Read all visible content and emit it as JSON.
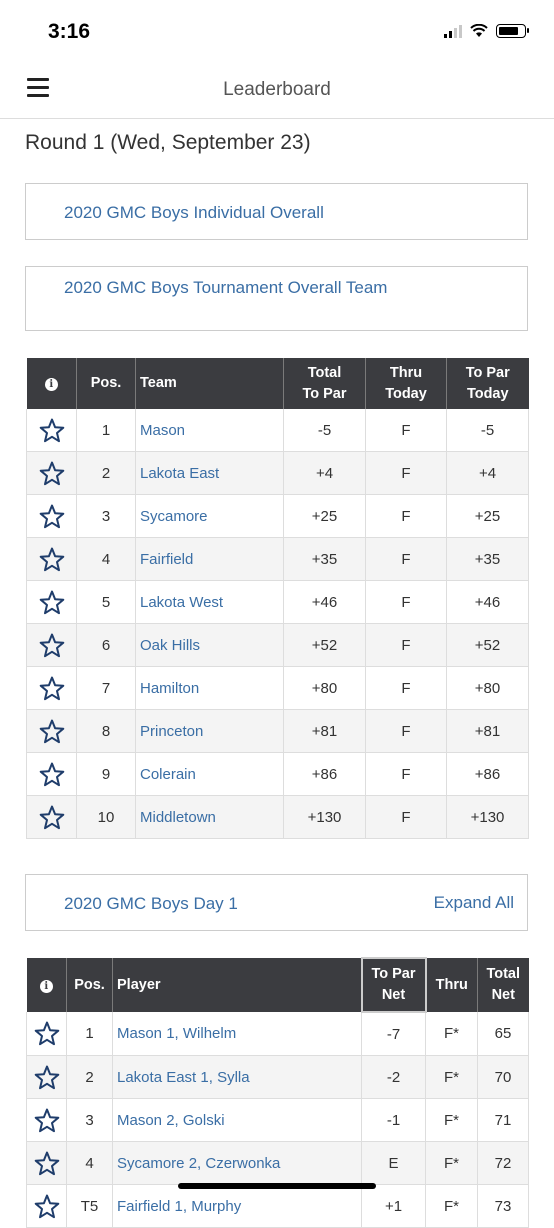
{
  "status_bar": {
    "time": "3:16",
    "signal_icon": "cellular-signal-icon",
    "wifi_icon": "wifi-icon",
    "battery_icon": "battery-icon"
  },
  "nav": {
    "title": "Leaderboard",
    "menu_icon": "hamburger-menu-icon"
  },
  "round_title": "Round 1 (Wed, September 23)",
  "links": {
    "individual_overall": "2020 GMC Boys Individual Overall",
    "team_overall": "2020 GMC Boys Tournament Overall Team"
  },
  "team_table": {
    "headers": {
      "info": "i",
      "pos": "Pos.",
      "team": "Team",
      "total_to_par_1": "Total",
      "total_to_par_2": "To Par",
      "thru_1": "Thru",
      "thru_2": "Today",
      "to_par_today_1": "To Par",
      "to_par_today_2": "Today"
    },
    "rows": [
      {
        "pos": "1",
        "team": "Mason",
        "total": "-5",
        "thru": "F",
        "today": "-5"
      },
      {
        "pos": "2",
        "team": "Lakota East",
        "total": "+4",
        "thru": "F",
        "today": "+4"
      },
      {
        "pos": "3",
        "team": "Sycamore",
        "total": "+25",
        "thru": "F",
        "today": "+25"
      },
      {
        "pos": "4",
        "team": "Fairfield",
        "total": "+35",
        "thru": "F",
        "today": "+35"
      },
      {
        "pos": "5",
        "team": "Lakota West",
        "total": "+46",
        "thru": "F",
        "today": "+46"
      },
      {
        "pos": "6",
        "team": "Oak Hills",
        "total": "+52",
        "thru": "F",
        "today": "+52"
      },
      {
        "pos": "7",
        "team": "Hamilton",
        "total": "+80",
        "thru": "F",
        "today": "+80"
      },
      {
        "pos": "8",
        "team": "Princeton",
        "total": "+81",
        "thru": "F",
        "today": "+81"
      },
      {
        "pos": "9",
        "team": "Colerain",
        "total": "+86",
        "thru": "F",
        "today": "+86"
      },
      {
        "pos": "10",
        "team": "Middletown",
        "total": "+130",
        "thru": "F",
        "today": "+130"
      }
    ]
  },
  "day1": {
    "title": "2020 GMC Boys Day 1",
    "expand_all": "Expand All"
  },
  "player_table": {
    "headers": {
      "info": "i",
      "pos": "Pos.",
      "player": "Player",
      "to_par_net_1": "To Par",
      "to_par_net_2": "Net",
      "thru": "Thru",
      "total_net_1": "Total",
      "total_net_2": "Net"
    },
    "rows": [
      {
        "pos": "1",
        "player": "Mason 1, Wilhelm",
        "to_par": "-7",
        "thru": "F*",
        "total": "65"
      },
      {
        "pos": "2",
        "player": "Lakota East 1, Sylla",
        "to_par": "-2",
        "thru": "F*",
        "total": "70"
      },
      {
        "pos": "3",
        "player": "Mason 2, Golski",
        "to_par": "-1",
        "thru": "F*",
        "total": "71"
      },
      {
        "pos": "4",
        "player": "Sycamore 2, Czerwonka",
        "to_par": "E",
        "thru": "F*",
        "total": "72"
      },
      {
        "pos": "T5",
        "player": "Fairfield 1, Murphy",
        "to_par": "+1",
        "thru": "F*",
        "total": "73"
      }
    ]
  },
  "colors": {
    "link": "#3a6ea5",
    "header_bg": "#3b3c40",
    "row_alt": "#f4f4f4",
    "star_stroke": "#1f3d6b"
  }
}
